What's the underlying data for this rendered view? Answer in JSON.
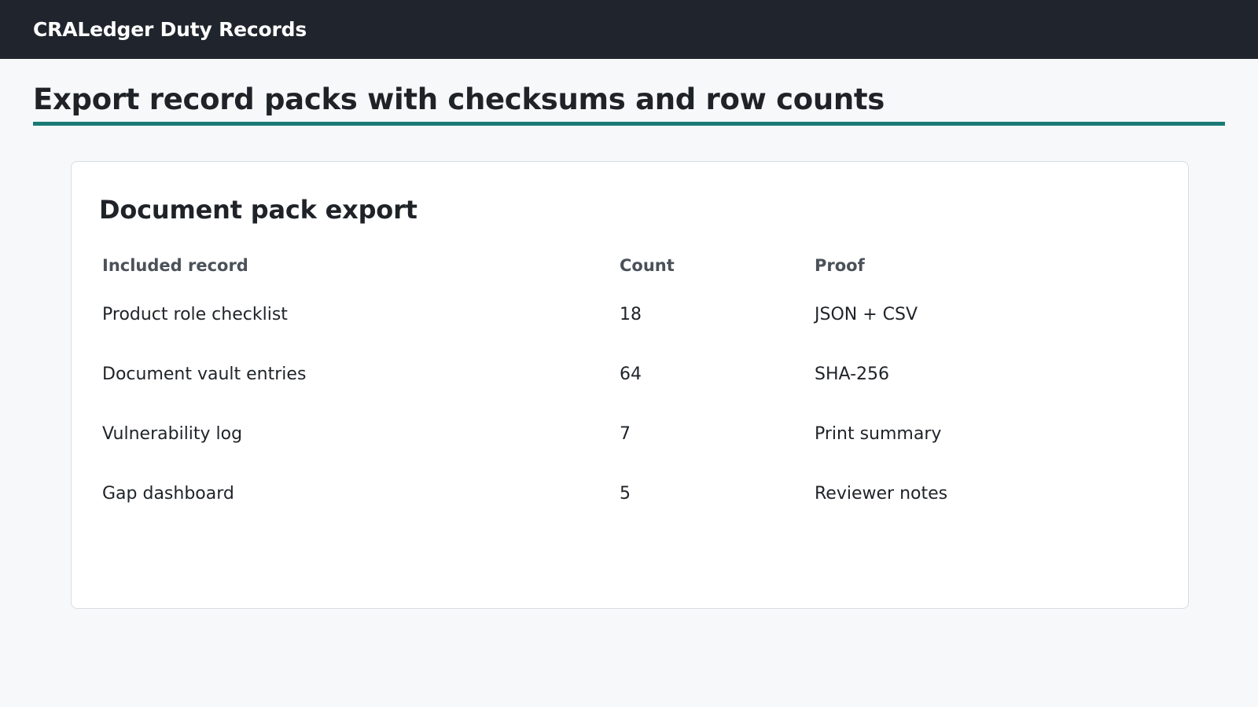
{
  "app": {
    "title": "CRALedger Duty Records"
  },
  "page": {
    "heading": "Export record packs with checksums and row counts"
  },
  "card": {
    "title": "Document pack export",
    "table": {
      "columns": [
        "Included record",
        "Count",
        "Proof"
      ],
      "rows": [
        {
          "record": "Product role checklist",
          "count": "18",
          "proof": "JSON + CSV"
        },
        {
          "record": "Document vault entries",
          "count": "64",
          "proof": "SHA-256"
        },
        {
          "record": "Vulnerability log",
          "count": "7",
          "proof": "Print summary"
        },
        {
          "record": "Gap dashboard",
          "count": "5",
          "proof": "Reviewer notes"
        }
      ]
    }
  },
  "colors": {
    "topbar": "#20252d",
    "accent": "#1a7a76",
    "background": "#f6f8fa"
  }
}
